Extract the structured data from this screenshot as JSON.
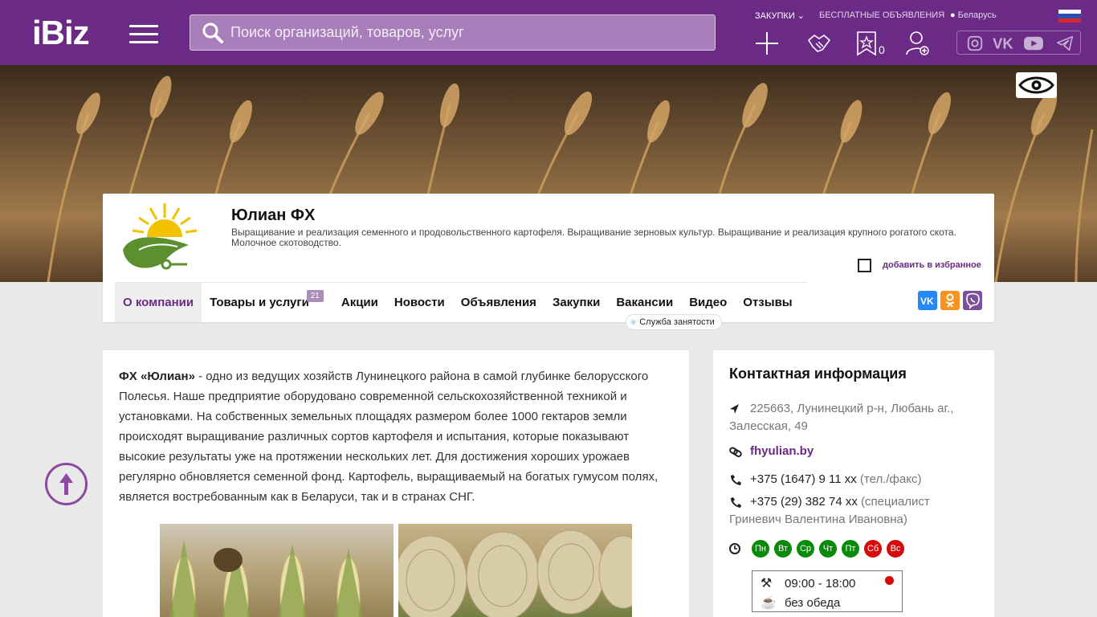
{
  "header": {
    "logo": "iBiz",
    "search_placeholder": "Поиск организаций, товаров, услуг",
    "nav": {
      "purchases": "ЗАКУПКИ",
      "free_ads": "БЕСПЛАТНЫЕ ОБЪЯВЛЕНИЯ",
      "region": "Беларусь"
    },
    "favorites_count": "0",
    "colors": {
      "bar": "#6a2a86",
      "accent": "#6a2a86"
    }
  },
  "company": {
    "name": "Юлиан ФХ",
    "description": "Выращивание и реализация семенного и продовольственного картофеля. Выращивание зерновых культур. Выращивание и реализация крупного рогатого скота. Молочное скотоводство.",
    "add_favorite": "добавить в избранное"
  },
  "tabs": [
    {
      "label": "О компании",
      "active": true
    },
    {
      "label": "Товары и услуги",
      "badge": "21"
    },
    {
      "label": "Акции"
    },
    {
      "label": "Новости"
    },
    {
      "label": "Объявления"
    },
    {
      "label": "Закупки"
    },
    {
      "label": "Вакансии"
    },
    {
      "label": "Видео"
    },
    {
      "label": "Отзывы"
    }
  ],
  "vacancy_note": "Служба занятости",
  "about": {
    "company_bold": "ФХ «Юлиан»",
    "text": " - одно из ведущих хозяйств Лунинецкого района в самой глубинке белорусского Полесья. Наше предприятие оборудовано современной сельскохозяйственной техникой и установками. На собственных земельных площадях размером более 1000 гектаров земли происходят выращивание различных сортов картофеля и испытания, которые показывают высокие результаты уже на протяжении нескольких лет. Для достижения хороших урожаев регулярно обновляется семенной фонд. Картофель, выращиваемый на богатых гумусом полях, является востребованным как в Беларуси, так и в странах СНГ."
  },
  "contacts": {
    "title": "Контактная информация",
    "address": "225663, Лунинецкий р-н, Любань аг., Залесская, 49",
    "website": "fhyulian.by",
    "phone1": "+375 (1647) 9 11 xx",
    "phone1_note": "(тел./факс)",
    "phone2": "+375 (29) 382 74 xx",
    "phone2_note": "(специалист Гриневич Валентина Ивановна)",
    "days": [
      {
        "label": "Пн",
        "color": "#0a8a0a"
      },
      {
        "label": "Вт",
        "color": "#0a8a0a"
      },
      {
        "label": "Ср",
        "color": "#0a8a0a"
      },
      {
        "label": "Чт",
        "color": "#0a8a0a"
      },
      {
        "label": "Пт",
        "color": "#0a8a0a"
      },
      {
        "label": "Сб",
        "color": "#d60a0a"
      },
      {
        "label": "Вс",
        "color": "#d60a0a"
      }
    ],
    "hours": "09:00 - 18:00",
    "lunch": "без обеда",
    "status_color": "#d60a0a"
  }
}
